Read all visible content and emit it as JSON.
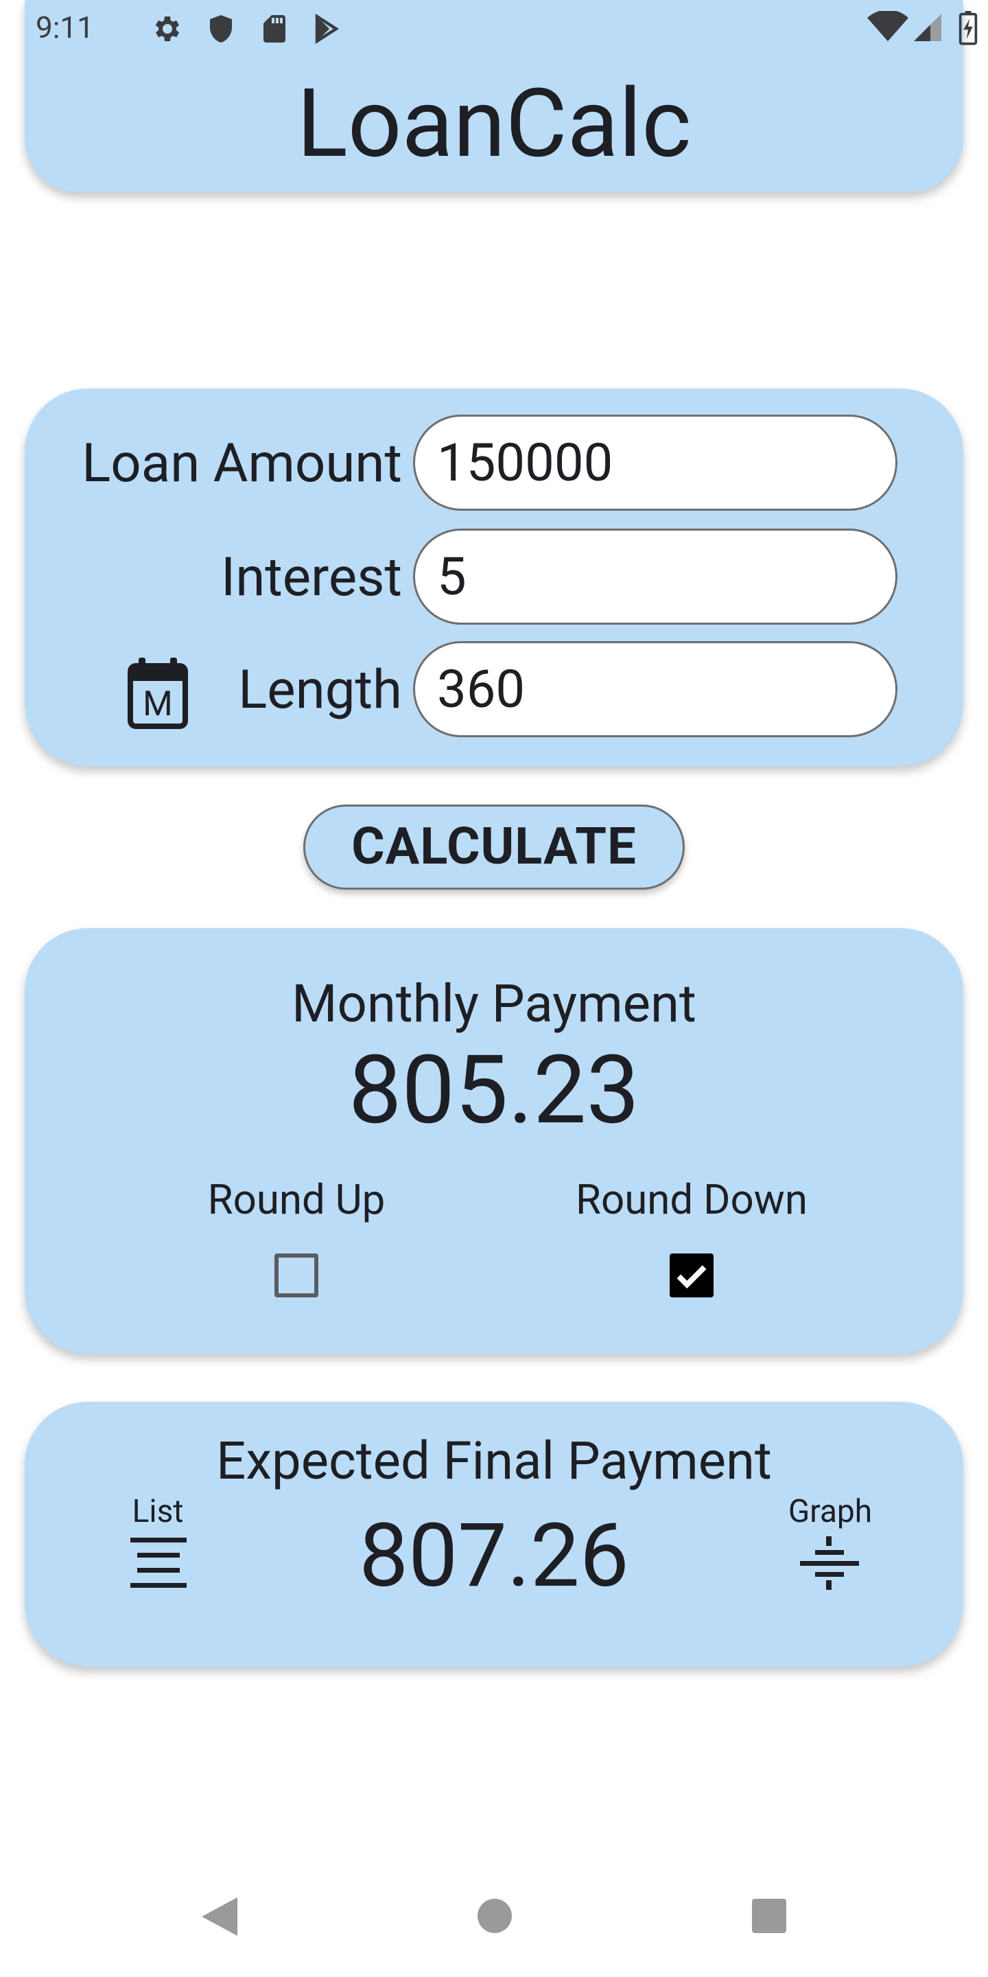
{
  "status_bar": {
    "time": "9:11",
    "icons": [
      "gear-icon",
      "shield-icon",
      "sd-card-icon",
      "play-store-icon",
      "wifi-icon",
      "cell-signal-icon",
      "battery-charging-icon"
    ]
  },
  "app": {
    "title": "LoanCalc"
  },
  "inputs": {
    "loan_amount_label": "Loan Amount",
    "loan_amount_value": "150000",
    "interest_label": "Interest",
    "interest_value": "5",
    "length_label": "Length",
    "length_value": "360",
    "length_unit_icon": "calendar-month-icon",
    "length_unit_letter": "M"
  },
  "calculate_button": {
    "label": "CALCULATE"
  },
  "monthly": {
    "label": "Monthly Payment",
    "value": "805.23",
    "round_up_label": "Round Up",
    "round_up_checked": false,
    "round_down_label": "Round Down",
    "round_down_checked": true
  },
  "final": {
    "label": "Expected Final Payment",
    "value": "807.26",
    "list_label": "List",
    "graph_label": "Graph"
  },
  "colors": {
    "card_background": "#bbdcf7",
    "text": "#1d1f24",
    "field_border": "#6f6f6f"
  },
  "nav_bar": {
    "icons": [
      "back-icon",
      "home-icon",
      "recents-icon"
    ]
  }
}
